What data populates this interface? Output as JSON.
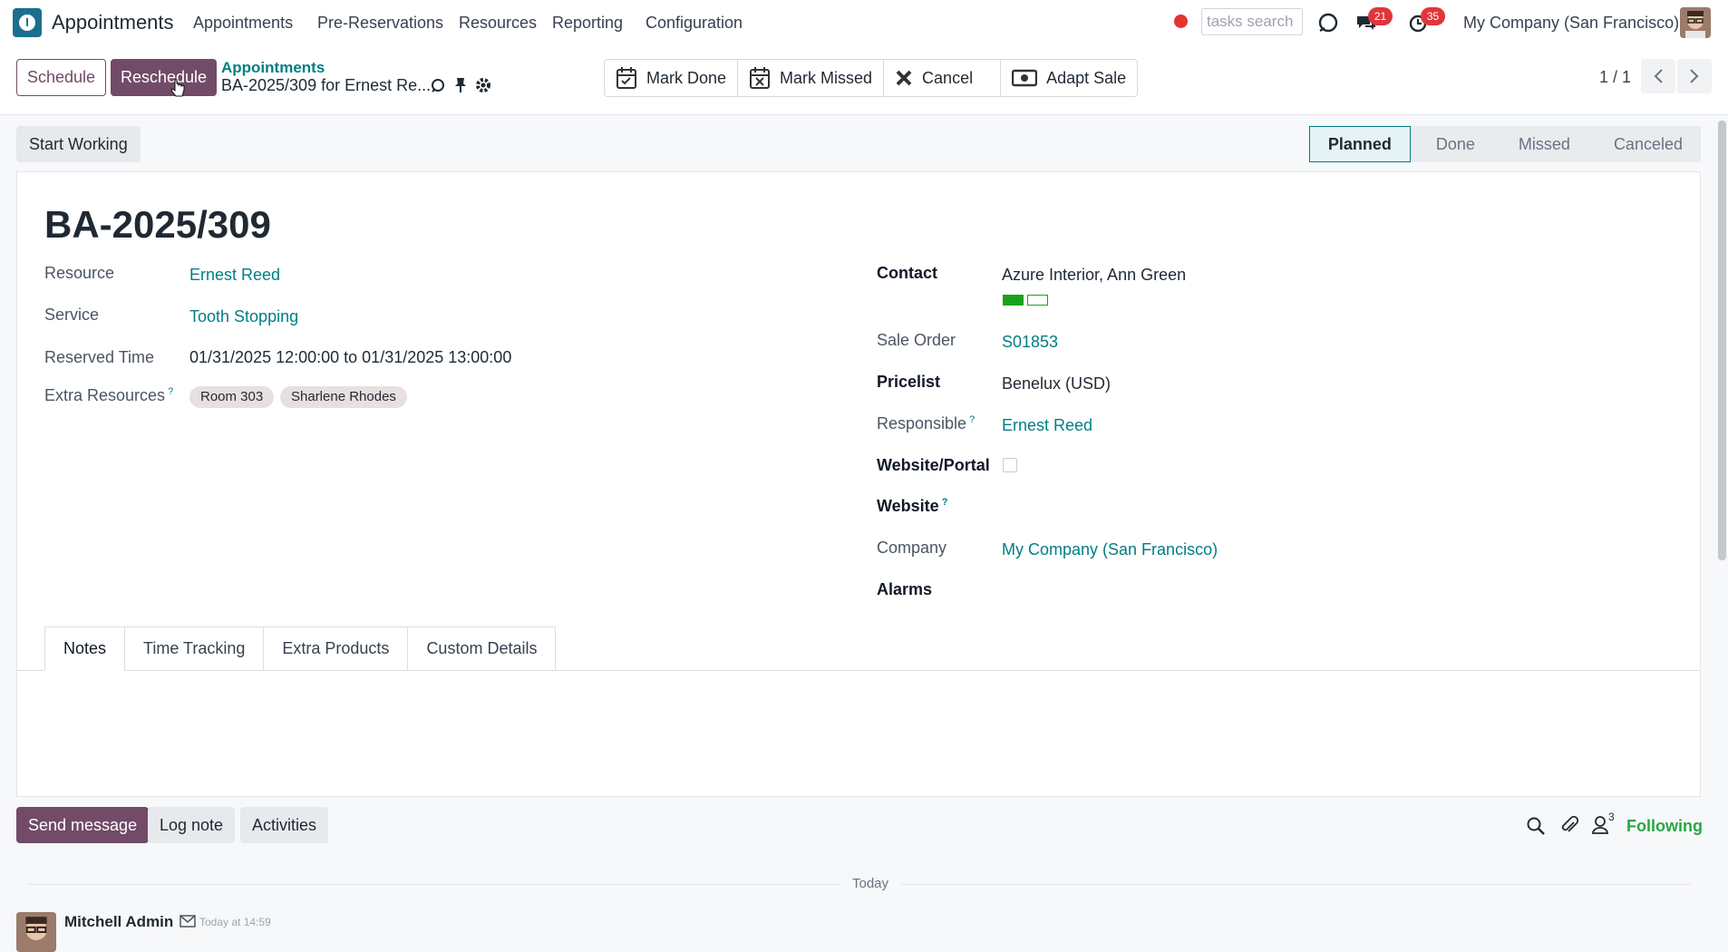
{
  "navbar": {
    "app_name": "Appointments",
    "menu": [
      "Appointments",
      "Pre-Reservations",
      "Resources",
      "Reporting",
      "Configuration"
    ],
    "search_placeholder": "tasks search",
    "messages_count": "21",
    "activities_count": "35",
    "company": "My Company (San Francisco)"
  },
  "control": {
    "schedule_label": "Schedule",
    "reschedule_label": "Reschedule",
    "breadcrumb_parent": "Appointments",
    "breadcrumb_current": "BA-2025/309 for Ernest Re...",
    "actions": [
      "Mark Done",
      "Mark Missed",
      "Cancel",
      "Adapt Sale"
    ],
    "pager": "1 / 1"
  },
  "status": {
    "start_working_label": "Start Working",
    "stages": [
      "Planned",
      "Done",
      "Missed",
      "Canceled"
    ],
    "active_stage": "Planned"
  },
  "form": {
    "title": "BA-2025/309",
    "left": {
      "resource_label": "Resource",
      "resource_value": "Ernest Reed",
      "service_label": "Service",
      "service_value": "Tooth Stopping",
      "reserved_label": "Reserved Time",
      "reserved_value": "01/31/2025 12:00:00 to 01/31/2025 13:00:00",
      "extra_label": "Extra Resources",
      "extra_help": "?",
      "extra_tags": [
        "Room 303",
        "Sharlene Rhodes"
      ]
    },
    "right": {
      "contact_label": "Contact",
      "contact_value": "Azure Interior, Ann Green",
      "sale_order_label": "Sale Order",
      "sale_order_value": "S01853",
      "pricelist_label": "Pricelist",
      "pricelist_value": "Benelux (USD)",
      "responsible_label": "Responsible",
      "responsible_help": "?",
      "responsible_value": "Ernest Reed",
      "website_portal_label": "Website/Portal",
      "website_label": "Website",
      "website_help": "?",
      "company_label": "Company",
      "company_value": "My Company (San Francisco)",
      "alarms_label": "Alarms"
    },
    "tabs": [
      "Notes",
      "Time Tracking",
      "Extra Products",
      "Custom Details"
    ]
  },
  "chatter": {
    "send_message_label": "Send message",
    "log_note_label": "Log note",
    "activities_label": "Activities",
    "followers_count": "3",
    "following_label": "Following",
    "date_separator": "Today",
    "message_author": "Mitchell Admin",
    "message_time": "Today at 14:59"
  },
  "colors": {
    "brand": "#714b67",
    "link": "#017e84",
    "badge": "#e0353c"
  }
}
